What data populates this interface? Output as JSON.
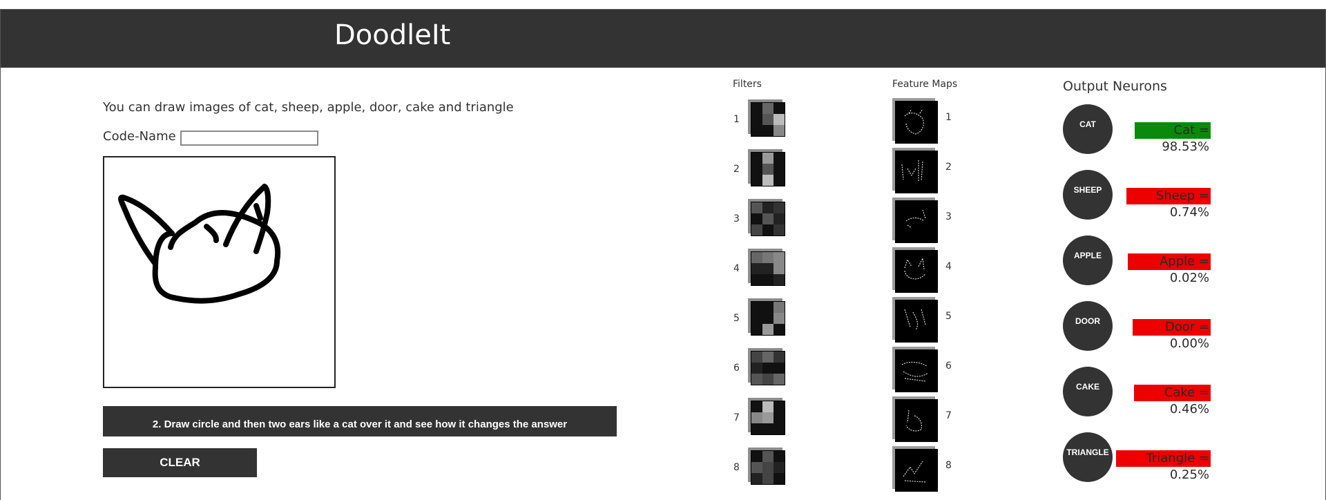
{
  "header": {
    "title": "DoodleIt"
  },
  "intro": {
    "text": "You can draw images of cat, sheep, apple, door, cake and triangle"
  },
  "codename": {
    "label": "Code-Name :",
    "value": ""
  },
  "hint": {
    "text": "2. Draw circle and then two ears like a cat over it and see how it changes the answer"
  },
  "clear": {
    "label": "CLEAR"
  },
  "filters": {
    "title": "Filters",
    "items": [
      {
        "num": "1",
        "cells": [
          "#111",
          "#666",
          "#111",
          "#111",
          "#555",
          "#bbb",
          "#111",
          "#111",
          "#888"
        ]
      },
      {
        "num": "2",
        "cells": [
          "#111",
          "#999",
          "#111",
          "#111",
          "#555",
          "#111",
          "#111",
          "#bbb",
          "#111"
        ]
      },
      {
        "num": "3",
        "cells": [
          "#555",
          "#222",
          "#333",
          "#111",
          "#555",
          "#222",
          "#444",
          "#111",
          "#333"
        ]
      },
      {
        "num": "4",
        "cells": [
          "#666",
          "#777",
          "#888",
          "#222",
          "#222",
          "#888",
          "#111",
          "#111",
          "#222"
        ]
      },
      {
        "num": "5",
        "cells": [
          "#111",
          "#111",
          "#777",
          "#111",
          "#111",
          "#888",
          "#111",
          "#999",
          "#111"
        ]
      },
      {
        "num": "6",
        "cells": [
          "#444",
          "#666",
          "#333",
          "#222",
          "#111",
          "#111",
          "#555",
          "#444",
          "#666"
        ]
      },
      {
        "num": "7",
        "cells": [
          "#111",
          "#bbb",
          "#111",
          "#888",
          "#999",
          "#111",
          "#111",
          "#111",
          "#111"
        ]
      },
      {
        "num": "8",
        "cells": [
          "#111",
          "#555",
          "#111",
          "#555",
          "#444",
          "#222",
          "#222",
          "#444",
          "#111"
        ]
      }
    ]
  },
  "feature_maps": {
    "title": "Feature Maps",
    "items": [
      {
        "num": "1"
      },
      {
        "num": "2"
      },
      {
        "num": "3"
      },
      {
        "num": "4"
      },
      {
        "num": "5"
      },
      {
        "num": "6"
      },
      {
        "num": "7"
      },
      {
        "num": "8"
      }
    ]
  },
  "outputs": {
    "title": "Output Neurons",
    "items": [
      {
        "label": "CAT",
        "score": "Cat = 98.53%",
        "color": "#0a8a0a",
        "width": 110
      },
      {
        "label": "SHEEP",
        "score": "Sheep = 0.74%",
        "color": "#ee0000",
        "width": 122
      },
      {
        "label": "APPLE",
        "score": "Apple = 0.02%",
        "color": "#ee0000",
        "width": 120
      },
      {
        "label": "DOOR",
        "score": "Door = 0.00%",
        "color": "#ee0000",
        "width": 113
      },
      {
        "label": "CAKE",
        "score": "Cake = 0.46%",
        "color": "#ee0000",
        "width": 111
      },
      {
        "label": "TRIANGLE",
        "score": "Triangle = 0.25%",
        "color": "#ee0000",
        "width": 137
      }
    ]
  }
}
